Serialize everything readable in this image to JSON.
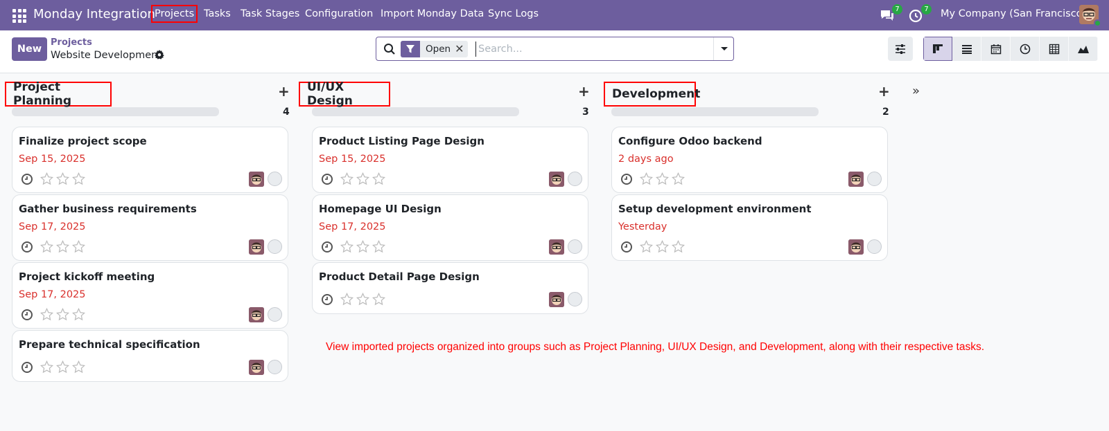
{
  "navbar": {
    "app_title": "Monday Integration",
    "menu": [
      {
        "label": "Projects",
        "active": true
      },
      {
        "label": "Tasks",
        "active": false
      },
      {
        "label": "Task Stages",
        "active": false
      },
      {
        "label": "Configuration",
        "active": false
      },
      {
        "label": "Import Monday Data",
        "active": false
      },
      {
        "label": "Sync Logs",
        "active": false
      }
    ],
    "messages_badge": "7",
    "activities_badge": "7",
    "company": "My Company (San Francisco)"
  },
  "control_panel": {
    "new_label": "New",
    "breadcrumb_parent": "Projects",
    "breadcrumb_current": "Website Development",
    "search": {
      "facet_label": "Open",
      "placeholder": "Search..."
    },
    "views": [
      "kanban",
      "list",
      "calendar",
      "activity",
      "pivot",
      "graph"
    ],
    "active_view": "kanban"
  },
  "columns": [
    {
      "title": "Project Planning",
      "count": "4",
      "cards": [
        {
          "title": "Finalize project scope",
          "date": "Sep 15, 2025",
          "stars": 0
        },
        {
          "title": "Gather business requirements",
          "date": "Sep 17, 2025",
          "stars": 0
        },
        {
          "title": "Project kickoff meeting",
          "date": "Sep 17, 2025",
          "stars": 0
        },
        {
          "title": "Prepare technical specification",
          "date": "",
          "stars": 0
        }
      ]
    },
    {
      "title": "UI/UX Design",
      "count": "3",
      "cards": [
        {
          "title": "Product Listing Page Design",
          "date": "Sep 15, 2025",
          "stars": 0
        },
        {
          "title": "Homepage UI Design",
          "date": "Sep 17, 2025",
          "stars": 0
        },
        {
          "title": "Product Detail Page Design",
          "date": "",
          "stars": 0
        }
      ]
    },
    {
      "title": "Development",
      "count": "2",
      "cards": [
        {
          "title": "Configure Odoo backend",
          "date": "2 days ago",
          "stars": 0
        },
        {
          "title": "Setup development environment",
          "date": "Yesterday",
          "stars": 0
        }
      ]
    }
  ],
  "annotation": "View imported projects organized into groups such as Project Planning, UI/UX Design, and Development, along with their respective tasks.",
  "colors": {
    "brand": "#6d5e9e",
    "overdue": "#d9302c",
    "highlight": "#ff0000"
  }
}
